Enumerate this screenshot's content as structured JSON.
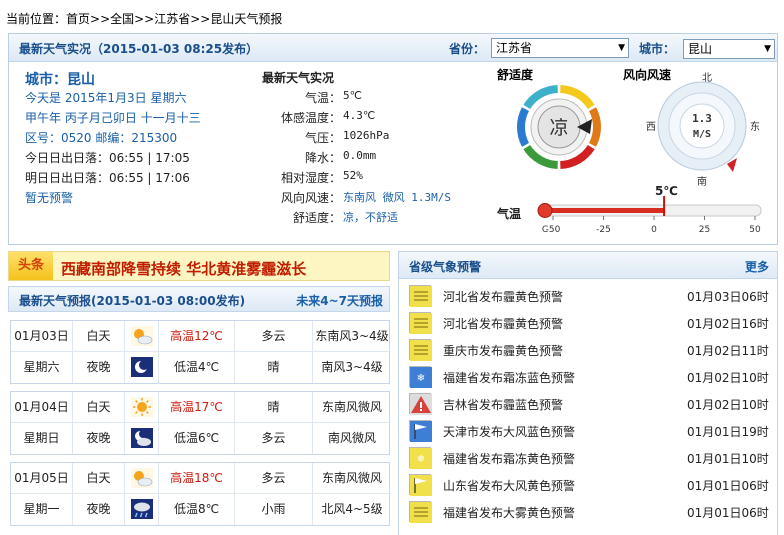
{
  "breadcrumb": {
    "prefix": "当前位置：",
    "path": "首页>>全国>>江苏省>>昆山天气预报"
  },
  "top": {
    "title": "最新天气实况（2015-01-03  08:25发布）",
    "province_label": "省份：",
    "province_value": "江苏省",
    "city_label": "城市：",
    "city_value": "昆山"
  },
  "city": {
    "name": "城市：昆山",
    "today": "今天是 2015年1月3日 星期六",
    "lunar": "甲午年 丙子月己卯日 十一月十三",
    "codes": "区号：0520   邮编：215300",
    "sun_today": "今日日出日落：06:55 | 17:05",
    "sun_tomorrow": "明日日出日落：06:55 | 17:06",
    "alert": "暂无预警"
  },
  "obs": {
    "title": "最新天气实况",
    "rows": [
      {
        "label": "气温：",
        "value": "5℃",
        "blue": false
      },
      {
        "label": "体感温度：",
        "value": "4.3℃",
        "blue": false
      },
      {
        "label": "气压：",
        "value": "1026hPa",
        "blue": false
      },
      {
        "label": "降水：",
        "value": "0.0mm",
        "blue": false
      },
      {
        "label": "相对湿度：",
        "value": "52%",
        "blue": false
      },
      {
        "label": "风向风速：",
        "value": "东南风 微风 1.3M/S",
        "blue": true
      },
      {
        "label": "舒适度：",
        "value": "凉，不舒适",
        "blue": true
      }
    ]
  },
  "comfort": {
    "title": "舒适度",
    "value": "凉",
    "colors": [
      "#f3c91b",
      "#e07a19",
      "#d21f1f",
      "#3b9b3c",
      "#2a7bd1",
      "#3cb1c9"
    ]
  },
  "wind": {
    "title": "风向风速",
    "n": "北",
    "s": "南",
    "e": "东",
    "w": "西",
    "speed": "1.3",
    "unit": "M/S"
  },
  "thermo": {
    "label": "气温",
    "current": "5℃",
    "current_value": 5,
    "min": -50,
    "max": 50,
    "ticks": [
      "C",
      "-50",
      "-25",
      "0",
      "25",
      "50"
    ]
  },
  "headline": {
    "tag": "头条",
    "text": "西藏南部降雪持续 华北黄淮雾霾滋长"
  },
  "forecast": {
    "title": "最新天气预报(2015-01-03  08:00发布)",
    "more": "未来4~7天预报",
    "days": [
      {
        "date": "01月03日",
        "week": "星期六",
        "day": {
          "label": "白天",
          "icon": "partly-cloudy-icon",
          "temp": "高温12℃",
          "weather": "多云",
          "wind": "东南风3~4级"
        },
        "night": {
          "label": "夜晚",
          "icon": "moon-icon",
          "temp": "低温4℃",
          "weather": "晴",
          "wind": "南风3~4级"
        }
      },
      {
        "date": "01月04日",
        "week": "星期日",
        "day": {
          "label": "白天",
          "icon": "sun-icon",
          "temp": "高温17℃",
          "weather": "晴",
          "wind": "东南风微风"
        },
        "night": {
          "label": "夜晚",
          "icon": "moon-cloud-icon",
          "temp": "低温6℃",
          "weather": "多云",
          "wind": "南风微风"
        }
      },
      {
        "date": "01月05日",
        "week": "星期一",
        "day": {
          "label": "白天",
          "icon": "partly-cloudy-icon",
          "temp": "高温18℃",
          "weather": "多云",
          "wind": "东南风微风"
        },
        "night": {
          "label": "夜晚",
          "icon": "rain-night-icon",
          "temp": "低温8℃",
          "weather": "小雨",
          "wind": "北风4~5级"
        }
      }
    ]
  },
  "warnings": {
    "title": "省级气象预警",
    "more": "更多",
    "items": [
      {
        "text": "河北省发布霾黄色预警",
        "time": "01月03日06时",
        "icon": "haze-yellow-icon",
        "color": "#f1e04a"
      },
      {
        "text": "河北省发布霾黄色预警",
        "time": "01月02日16时",
        "icon": "haze-yellow-icon",
        "color": "#f1e04a"
      },
      {
        "text": "重庆市发布霾黄色预警",
        "time": "01月02日11时",
        "icon": "haze-yellow-icon",
        "color": "#f1e04a"
      },
      {
        "text": "福建省发布霜冻蓝色预警",
        "time": "01月02日10时",
        "icon": "frost-blue-icon",
        "color": "#3d7fd4"
      },
      {
        "text": "吉林省发布霾蓝色预警",
        "time": "01月02日10时",
        "icon": "haze-blue-icon",
        "color": "#d4443a"
      },
      {
        "text": "天津市发布大风蓝色预警",
        "time": "01月01日19时",
        "icon": "wind-blue-icon",
        "color": "#3d7fd4"
      },
      {
        "text": "福建省发布霜冻黄色预警",
        "time": "01月01日10时",
        "icon": "frost-yellow-icon",
        "color": "#f1e04a"
      },
      {
        "text": "山东省发布大风黄色预警",
        "time": "01月01日06时",
        "icon": "wind-yellow-icon",
        "color": "#f1e04a"
      },
      {
        "text": "福建省发布大雾黄色预警",
        "time": "01月01日06时",
        "icon": "fog-yellow-icon",
        "color": "#f1e04a"
      }
    ]
  }
}
